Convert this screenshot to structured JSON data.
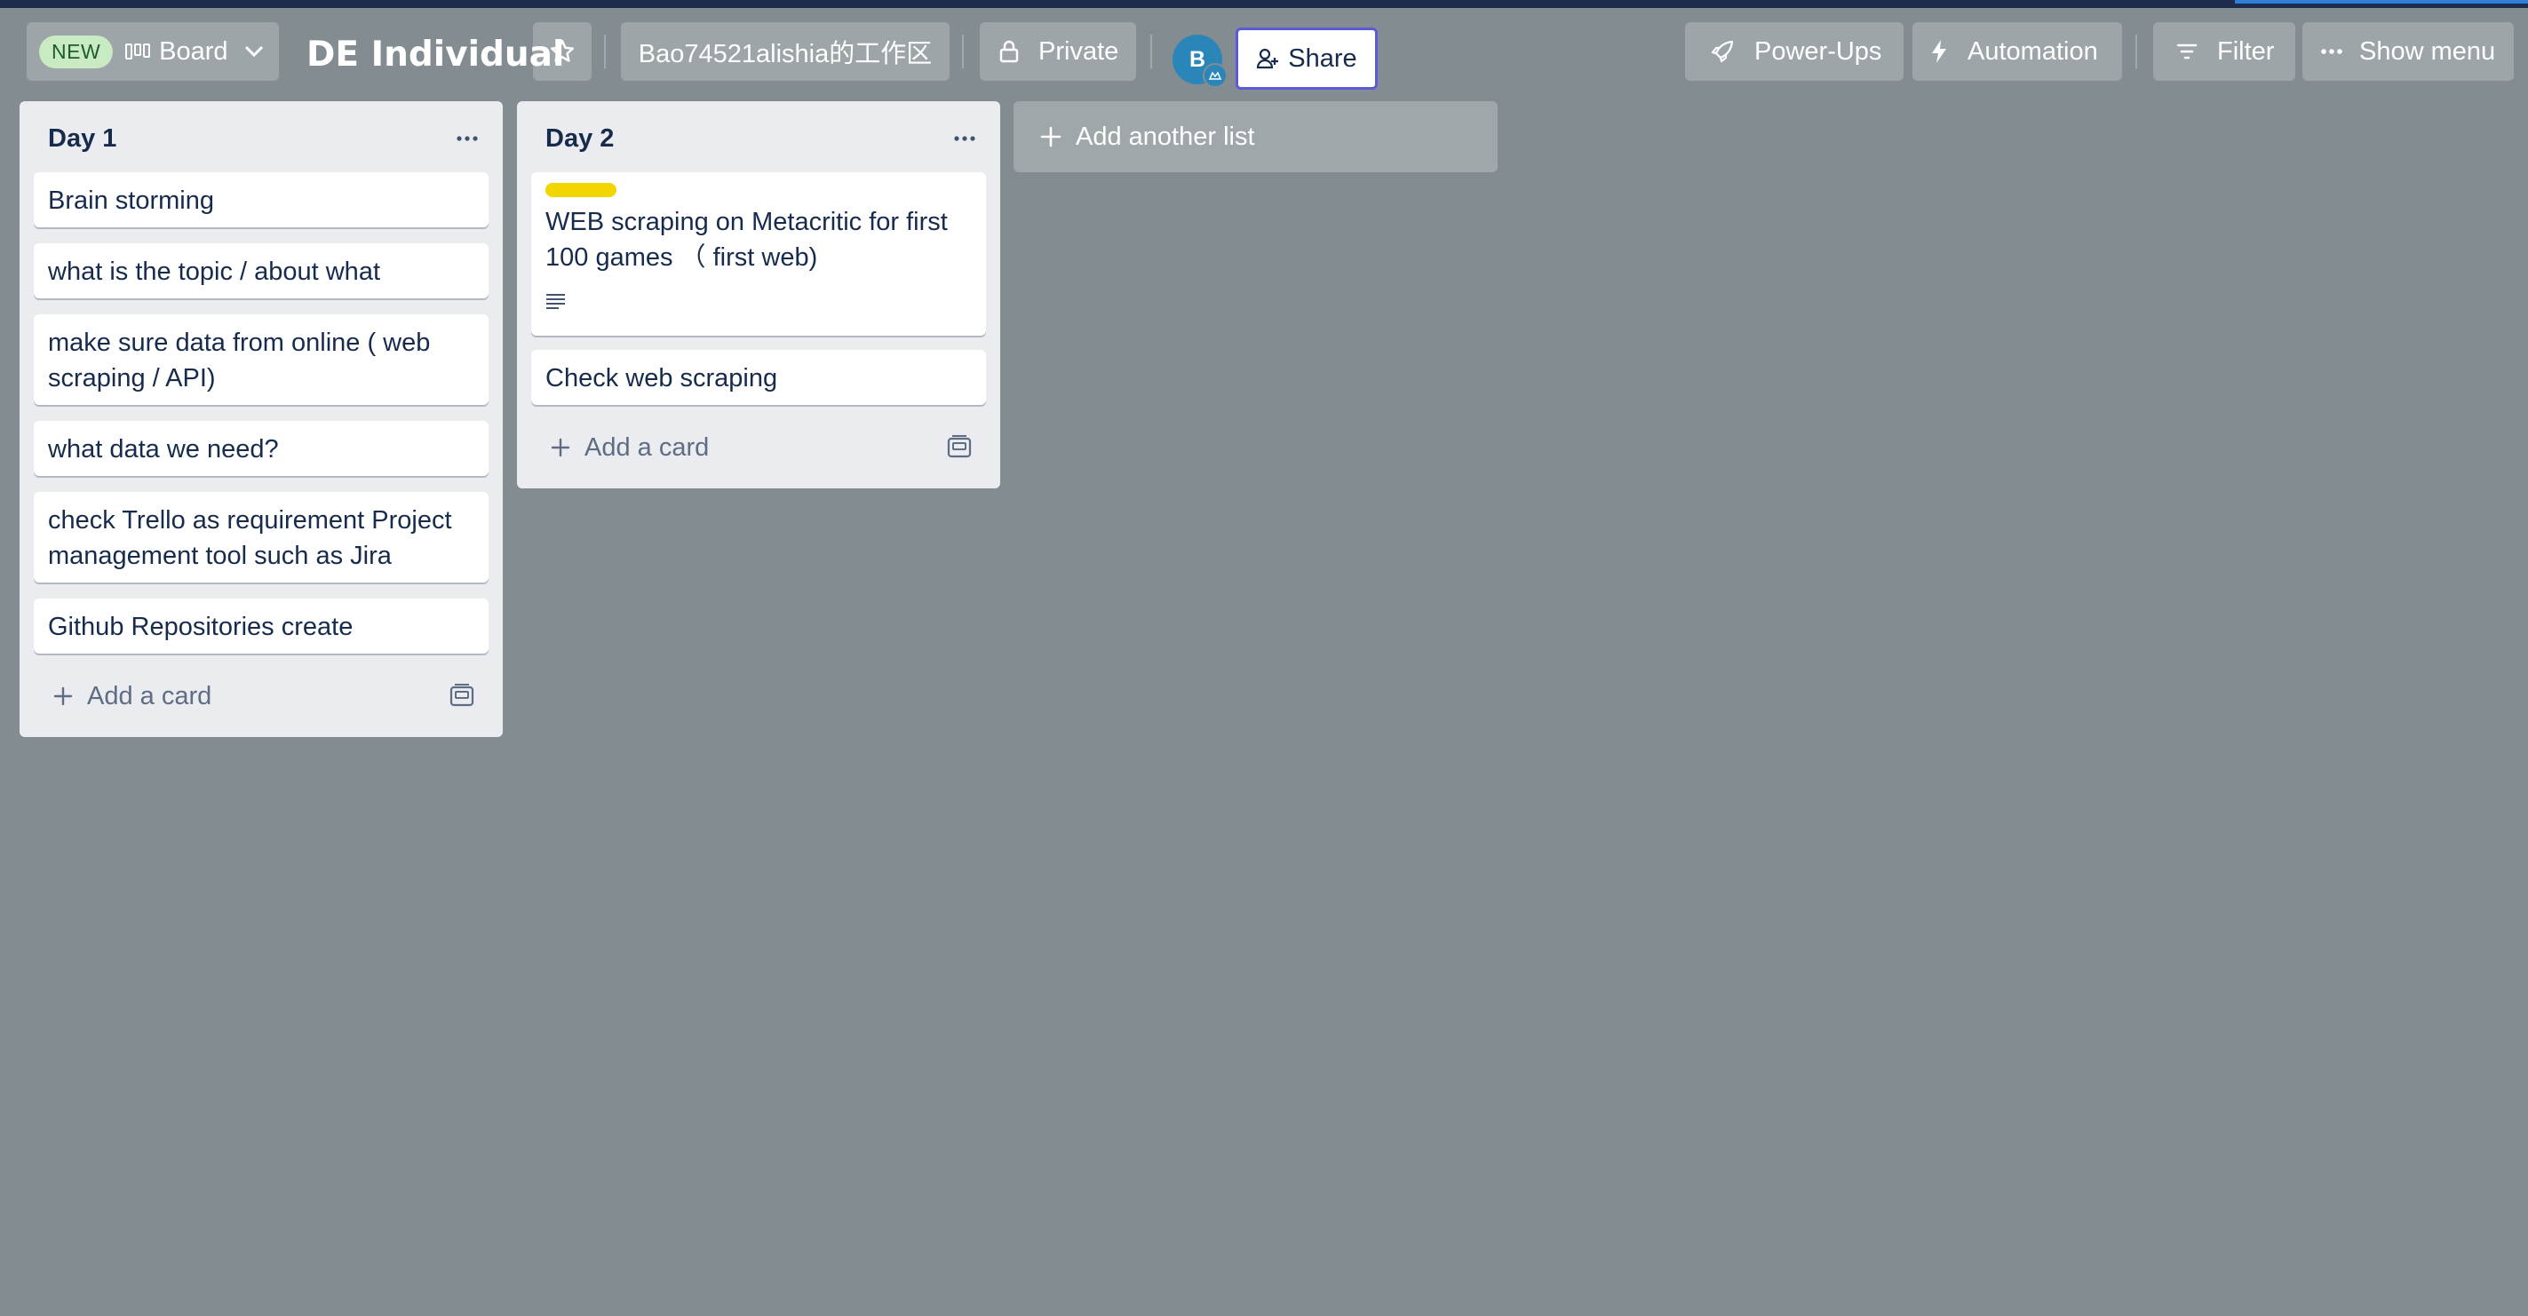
{
  "header": {
    "new_badge": "NEW",
    "view_label": "Board",
    "board_title": "DE Individual",
    "workspace": "Bao74521alishia的工作区",
    "visibility": "Private",
    "avatar_initial": "B",
    "share_label": "Share",
    "powerups_label": "Power-Ups",
    "automation_label": "Automation",
    "filter_label": "Filter",
    "show_menu_label": "Show menu"
  },
  "lists": [
    {
      "title": "Day 1",
      "cards": [
        {
          "text": "Brain storming"
        },
        {
          "text": "what is the topic / about what"
        },
        {
          "text": "make sure data from online ( web scraping / API)"
        },
        {
          "text": "what data we need?"
        },
        {
          "text": "check Trello as requirement Project management tool such as Jira"
        },
        {
          "text": "Github Repositories create"
        }
      ],
      "add_card_label": "Add a card"
    },
    {
      "title": "Day 2",
      "cards": [
        {
          "text": "WEB scraping on Metacritic for first 100 games （ first web)",
          "label_color": "#f2d600",
          "has_description": true
        },
        {
          "text": "Check web scraping"
        }
      ],
      "add_card_label": "Add a card"
    }
  ],
  "add_list_label": "Add another list",
  "colors": {
    "background": "#838c91",
    "list_bg": "#ebecf0",
    "share_border": "#5b5bd6",
    "label_yellow": "#f2d600",
    "new_badge_bg": "#c9ebc4",
    "avatar_bg": "#2a86b8"
  },
  "icons": {
    "board_view": "board-view-icon",
    "chevron": "chevron-down-icon",
    "star": "star-icon",
    "lock": "lock-icon",
    "share": "add-person-icon",
    "powerups": "rocket-icon",
    "automation": "lightning-icon",
    "filter": "filter-icon",
    "menu": "more-dots-icon",
    "description": "description-lines-icon",
    "template": "card-template-icon",
    "plus": "plus-icon"
  }
}
